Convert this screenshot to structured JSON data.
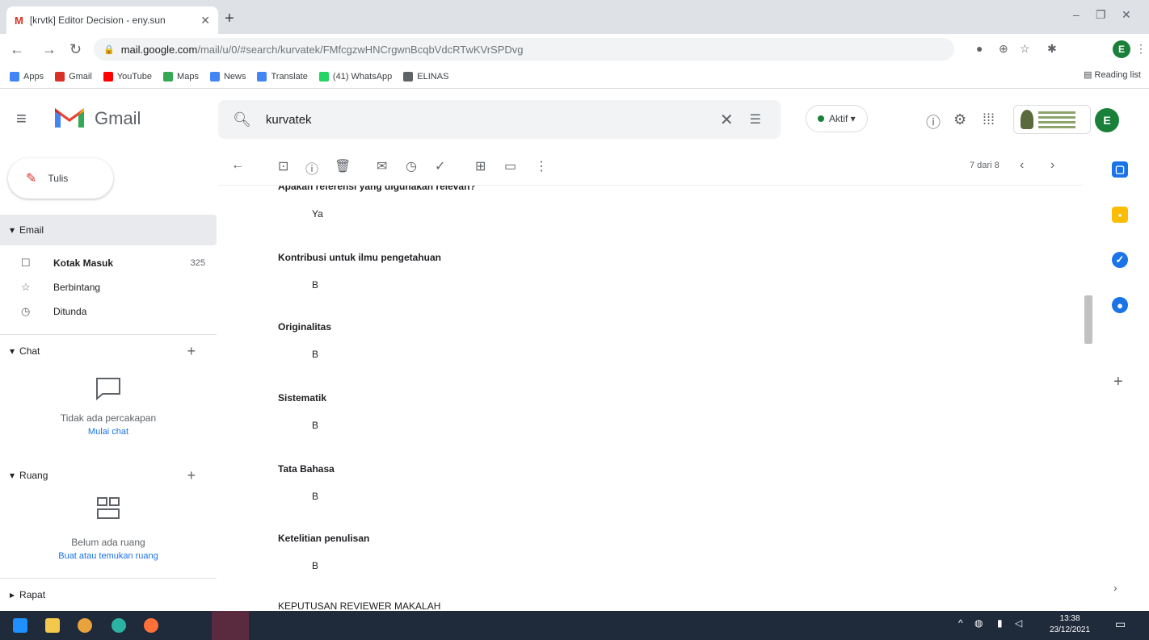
{
  "browser": {
    "tab_title": "[krvtk] Editor Decision - eny.sun",
    "tab_favicon": "M",
    "url_domain": "mail.google.com",
    "url_path": "/mail/u/0/#search/kurvatek/FMfcgzwHNCrgwnBcqbVdcRTwKVrSPDvg",
    "bookmarks": [
      {
        "label": "Apps",
        "color": "#4285f4"
      },
      {
        "label": "Gmail",
        "color": "#d93025"
      },
      {
        "label": "YouTube",
        "color": "#ff0000"
      },
      {
        "label": "Maps",
        "color": "#34a853"
      },
      {
        "label": "News",
        "color": "#4285f4"
      },
      {
        "label": "Translate",
        "color": "#4285f4"
      },
      {
        "label": "(41) WhatsApp",
        "color": "#25d366"
      },
      {
        "label": "ELINAS",
        "color": "#5f6368"
      }
    ],
    "reading_list": "Reading list",
    "profile_initial": "E"
  },
  "gmail": {
    "logo_text": "Gmail",
    "search_value": "kurvatek",
    "status_label": "Aktif ▾",
    "avatar_initial": "E",
    "compose_label": "Tulis",
    "sections": {
      "email": "Email",
      "chat": "Chat",
      "ruang": "Ruang",
      "rapat": "Rapat"
    },
    "folders": [
      {
        "label": "Kotak Masuk",
        "count": "325",
        "icon": "inbox-icon"
      },
      {
        "label": "Berbintang",
        "count": "",
        "icon": "star-icon"
      },
      {
        "label": "Ditunda",
        "count": "",
        "icon": "clock-icon"
      }
    ],
    "chat_empty": "Tidak ada percakapan",
    "chat_link": "Mulai chat",
    "room_empty": "Belum ada ruang",
    "room_link": "Buat atau temukan ruang",
    "pager": "7 dari 8"
  },
  "message": {
    "partial_top": "Apakah referensi yang digunakan relevan?",
    "items": [
      {
        "q": "",
        "a": "Ya"
      },
      {
        "q": "Kontribusi untuk ilmu pengetahuan",
        "a": "B"
      },
      {
        "q": "Originalitas",
        "a": "B"
      },
      {
        "q": "Sistematik",
        "a": "B"
      },
      {
        "q": "Tata Bahasa",
        "a": "B"
      },
      {
        "q": "Ketelitian penulisan",
        "a": "B"
      }
    ],
    "bottom_heading": "KEPUTUSAN REVIEWER MAKALAH"
  },
  "taskbar": {
    "time": "13:38",
    "date": "23/12/2021"
  }
}
